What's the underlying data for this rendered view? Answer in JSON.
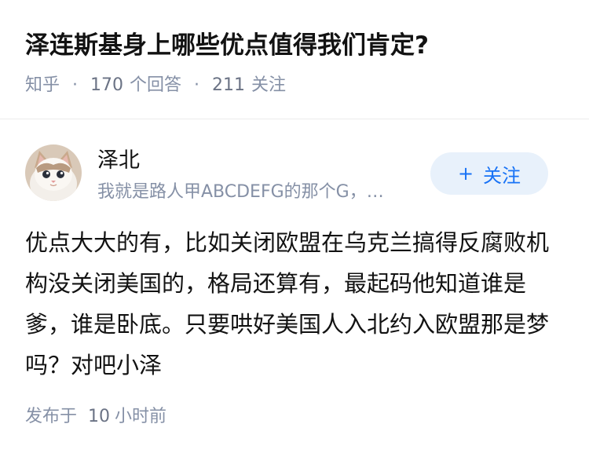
{
  "question": {
    "title": "泽连斯基身上哪些优点值得我们肯定?",
    "source": "知乎",
    "answer_count": "170",
    "answer_label": "个回答",
    "follower_count": "211",
    "follower_label": "关注"
  },
  "author": {
    "name": "泽北",
    "bio": "我就是路人甲ABCDEFG的那个G，…",
    "avatar_icon": "cat-avatar-icon"
  },
  "follow_button": {
    "icon": "plus-icon",
    "plus": "+",
    "label": "关注",
    "bg_color": "#e8f1fb",
    "text_color": "#1772f6"
  },
  "answer": {
    "content": "优点大大的有，比如关闭欧盟在乌克兰搞得反腐败机构没关闭美国的，格局还算有，最起码他知道谁是爹，谁是卧底。只要哄好美国人入北约入欧盟那是梦吗？对吧小泽"
  },
  "published": {
    "prefix": "发布于",
    "value": "10",
    "unit": "小时前"
  },
  "colors": {
    "meta_text": "#8590a6",
    "divider": "#ececec"
  }
}
